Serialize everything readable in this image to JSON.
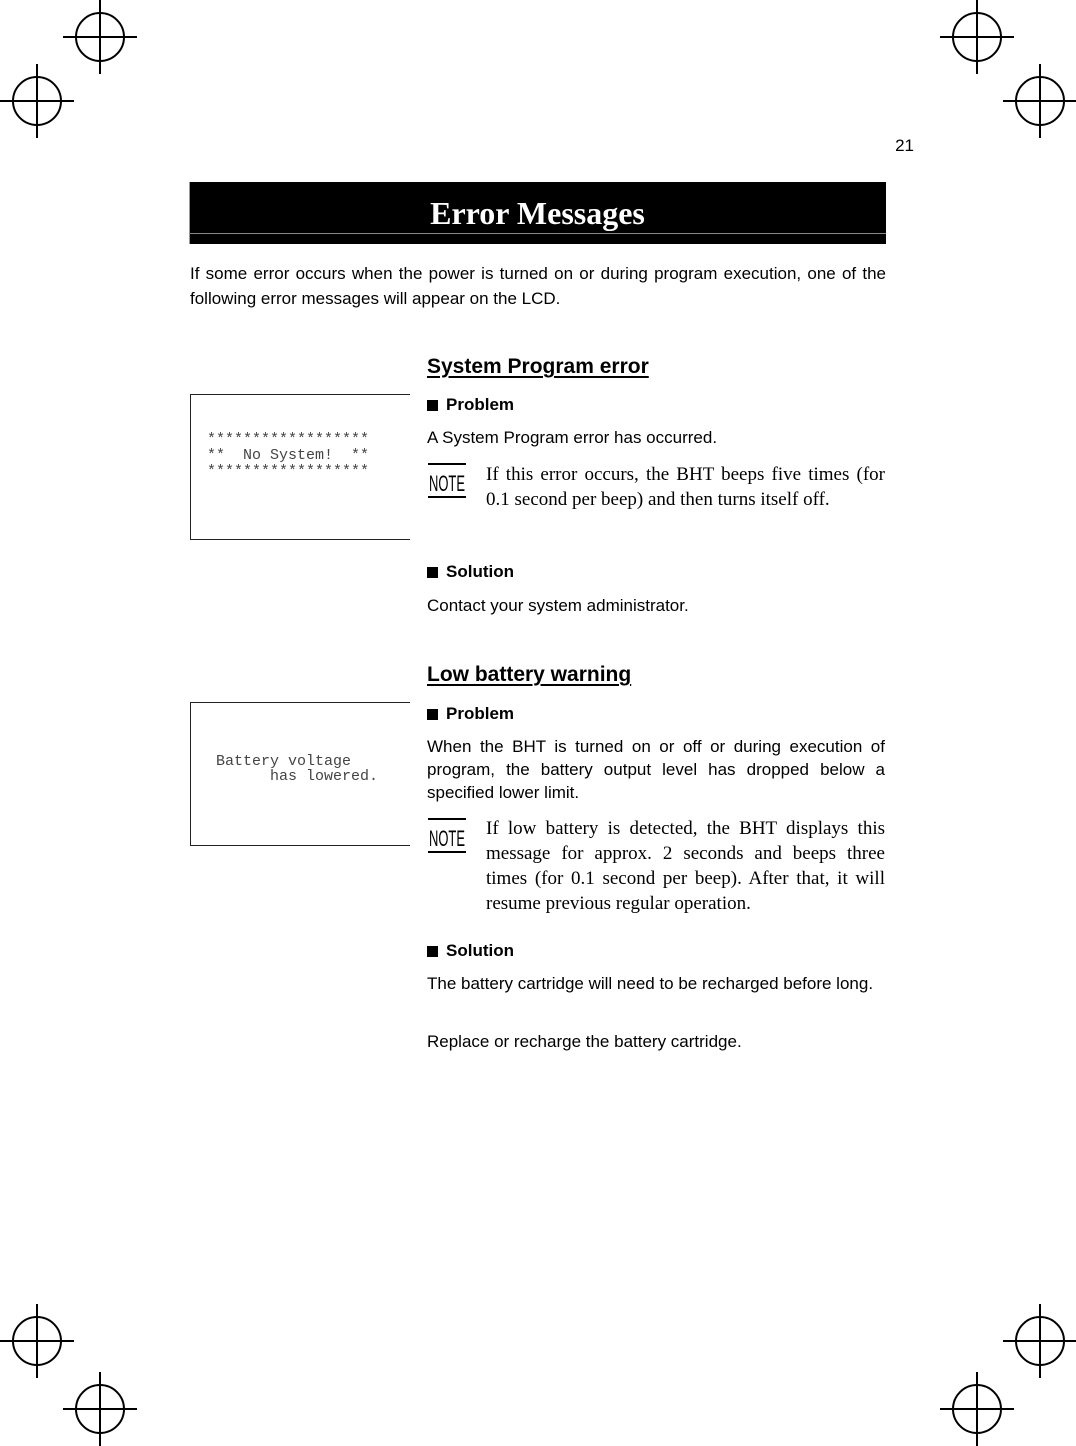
{
  "page": {
    "number": "21",
    "title": "Error Messages",
    "intro": "If some error occurs when the power is turned on or during program execution, one of the following error messages will appear on the LCD."
  },
  "icons": {
    "registration_mark": "crosshair-circle",
    "note": "note-icon",
    "bullet": "black-square"
  },
  "sections": [
    {
      "title": "System Program error",
      "lcd_lines": [
        "******************",
        "**  No System!  **",
        "******************"
      ],
      "problem_label": "Problem",
      "problem_text": "A System Program error has occurred.",
      "note_label": "NOTE",
      "note_text": "If this error occurs, the BHT beeps five times (for 0.1 second per beep) and then turns itself off.",
      "solution_label": "Solution",
      "solution_paragraphs": [
        "Contact your system administrator."
      ]
    },
    {
      "title": "Low battery warning",
      "lcd_lines": [
        "Battery voltage",
        "      has lowered."
      ],
      "problem_label": "Problem",
      "problem_text": "When the BHT is turned on or off or during execution of program, the battery output level has dropped below a specified lower limit.",
      "note_label": "NOTE",
      "note_text": "If low battery is detected, the BHT displays this message for approx. 2 seconds and beeps three times (for 0.1 second per beep). After that, it will resume previous regular operation.",
      "solution_label": "Solution",
      "solution_paragraphs": [
        "The battery cartridge will need to be recharged before long.",
        "Replace or recharge the battery cartridge."
      ]
    }
  ]
}
